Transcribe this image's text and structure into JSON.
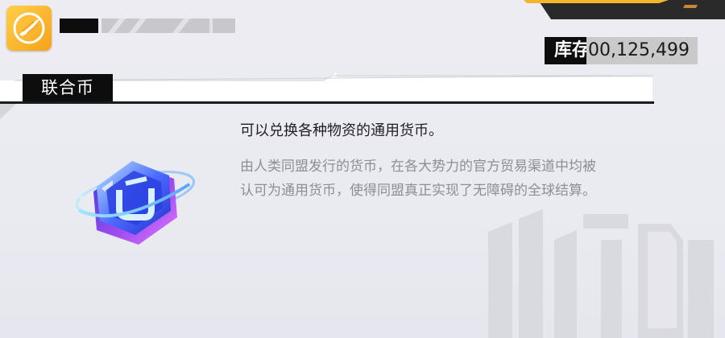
{
  "header": {
    "app_icon": "spark-feather-icon"
  },
  "inventory": {
    "label": "库存",
    "value": "00,125,499"
  },
  "item": {
    "name": "联合币",
    "icon": "hexagon-crystal-currency-icon",
    "summary": "可以兑换各种物资的通用货币。",
    "detail_line_1": "由人类同盟发行的货币，在各大势力的官方贸易渠道中均被",
    "detail_line_2": "认可为通用货币，使得同盟真正实现了无障碍的全球结算。"
  },
  "colors": {
    "accent": "#f7a21a",
    "panel_bg": "#eaeaf1",
    "dark": "#0d0d0d",
    "muted_text": "#8e8e96"
  }
}
